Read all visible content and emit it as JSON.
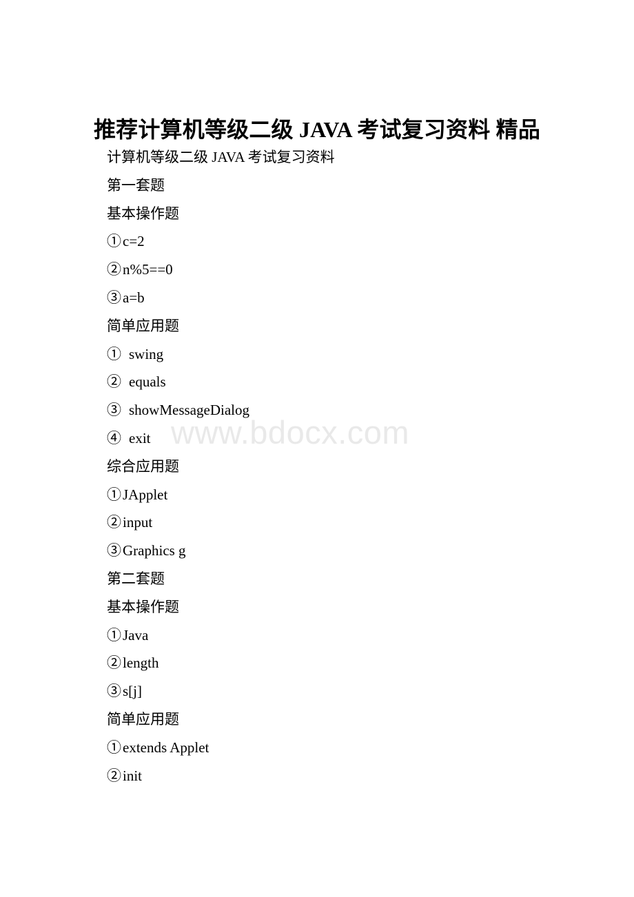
{
  "document": {
    "title": "推荐计算机等级二级 JAVA 考试复习资料 精品",
    "watermark": "www.bdocx.com",
    "subtitle": "计算机等级二级 JAVA 考试复习资料",
    "lines": [
      {
        "type": "heading",
        "text": "计算机等级二级 JAVA 考试复习资料"
      },
      {
        "type": "heading",
        "text": "第一套题"
      },
      {
        "type": "heading",
        "text": "基本操作题"
      },
      {
        "type": "item",
        "marker": "①",
        "spacing": "tight",
        "text": "c=2"
      },
      {
        "type": "item",
        "marker": "②",
        "spacing": "tight",
        "text": "n%5==0"
      },
      {
        "type": "item",
        "marker": "③",
        "spacing": "tight",
        "text": "a=b"
      },
      {
        "type": "heading",
        "text": "简单应用题"
      },
      {
        "type": "item",
        "marker": "①",
        "spacing": "wide",
        "text": "swing"
      },
      {
        "type": "item",
        "marker": "②",
        "spacing": "wide",
        "text": "equals"
      },
      {
        "type": "item",
        "marker": "③",
        "spacing": "wide",
        "text": "showMessageDialog"
      },
      {
        "type": "item",
        "marker": "④",
        "spacing": "wide",
        "text": "exit"
      },
      {
        "type": "heading",
        "text": "综合应用题"
      },
      {
        "type": "item",
        "marker": "①",
        "spacing": "tight",
        "text": "JApplet"
      },
      {
        "type": "item",
        "marker": "②",
        "spacing": "tight",
        "text": "input"
      },
      {
        "type": "item",
        "marker": "③",
        "spacing": "tight",
        "text": "Graphics g"
      },
      {
        "type": "heading",
        "text": "第二套题"
      },
      {
        "type": "heading",
        "text": "基本操作题"
      },
      {
        "type": "item",
        "marker": "①",
        "spacing": "tight",
        "text": "Java"
      },
      {
        "type": "item",
        "marker": "②",
        "spacing": "tight",
        "text": "length"
      },
      {
        "type": "item",
        "marker": "③",
        "spacing": "tight",
        "text": "s[j]"
      },
      {
        "type": "heading",
        "text": "简单应用题"
      },
      {
        "type": "item",
        "marker": "①",
        "spacing": "tight",
        "text": "extends Applet"
      },
      {
        "type": "item",
        "marker": "②",
        "spacing": "tight",
        "text": "init"
      }
    ]
  },
  "colors": {
    "page_background": "#ffffff",
    "text": "#000000",
    "watermark": "#e9e9e9"
  }
}
